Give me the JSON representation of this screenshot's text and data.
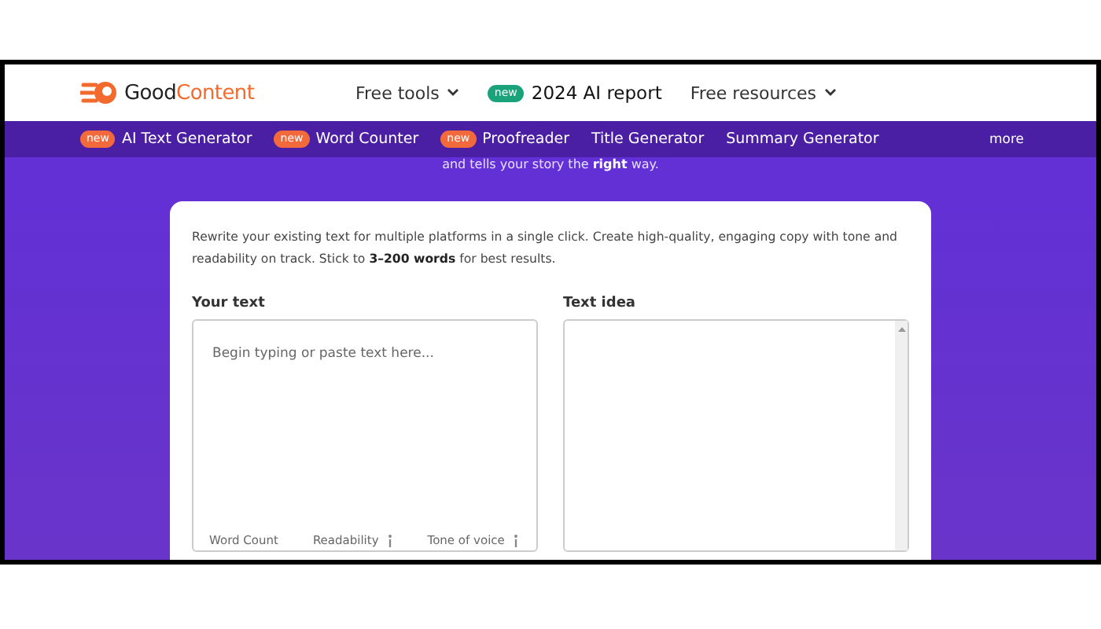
{
  "header": {
    "logo": {
      "first": "Good",
      "second": "Content"
    },
    "nav": [
      {
        "label": "Free tools",
        "dropdown": true
      },
      {
        "label": "2024 AI report",
        "badge": "new",
        "dropdown": false
      },
      {
        "label": "Free resources",
        "dropdown": true
      }
    ]
  },
  "subnav": {
    "items": [
      {
        "label": "AI Text Generator",
        "badge": "new"
      },
      {
        "label": "Word Counter",
        "badge": "new"
      },
      {
        "label": "Proofreader",
        "badge": "new"
      },
      {
        "label": "Title Generator"
      },
      {
        "label": "Summary Generator"
      }
    ],
    "more": "more"
  },
  "tagline": "and tells your story the **right** way.",
  "card": {
    "intro": "Rewrite your existing text for multiple platforms in a single click. Create high-quality, engaging copy with tone and readability on track. Stick to **3–200 words** for best results.",
    "input": {
      "label": "Your text",
      "placeholder": "Begin typing or paste text here...",
      "metrics": [
        {
          "label": "Word Count",
          "info": false
        },
        {
          "label": "Readability",
          "info": true
        },
        {
          "label": "Tone of voice",
          "info": true
        }
      ]
    },
    "output": {
      "label": "Text idea"
    }
  }
}
